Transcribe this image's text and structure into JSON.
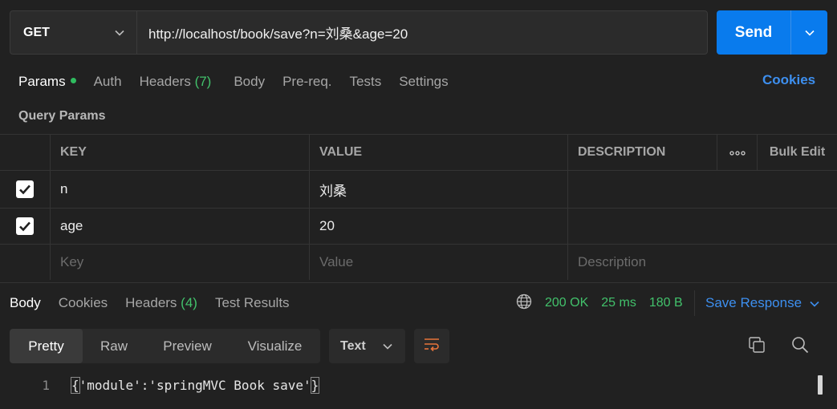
{
  "request": {
    "method": "GET",
    "url": "http://localhost/book/save?n=刘桑&age=20",
    "send_label": "Send"
  },
  "request_tabs": [
    {
      "label": "Params",
      "active": true,
      "dot": true
    },
    {
      "label": "Auth"
    },
    {
      "label": "Headers",
      "count": "(7)"
    },
    {
      "label": "Body"
    },
    {
      "label": "Pre-req."
    },
    {
      "label": "Tests"
    },
    {
      "label": "Settings"
    }
  ],
  "cookies_link": "Cookies",
  "query_params": {
    "title": "Query Params",
    "headers": {
      "key": "KEY",
      "value": "VALUE",
      "description": "DESCRIPTION",
      "bulk_edit": "Bulk Edit"
    },
    "rows": [
      {
        "checked": true,
        "key": "n",
        "value": "刘桑",
        "description": ""
      },
      {
        "checked": true,
        "key": "age",
        "value": "20",
        "description": ""
      }
    ],
    "placeholders": {
      "key": "Key",
      "value": "Value",
      "description": "Description"
    }
  },
  "response_tabs": [
    {
      "label": "Body",
      "active": true
    },
    {
      "label": "Cookies"
    },
    {
      "label": "Headers",
      "count": "(4)"
    },
    {
      "label": "Test Results"
    }
  ],
  "response_status": {
    "status": "200 OK",
    "time": "25 ms",
    "size": "180 B"
  },
  "save_response": "Save Response",
  "format_options": [
    "Pretty",
    "Raw",
    "Preview",
    "Visualize"
  ],
  "format_select": "Text",
  "code": {
    "line_number": "1",
    "open_brace": "{",
    "content": "'module':'springMVC Book save'",
    "close_brace": "}"
  },
  "colors": {
    "accent": "#097bed",
    "link": "#3d8fef",
    "success": "#42c16b",
    "background": "#212121"
  },
  "icons": [
    "chevron-down-icon",
    "checkbox-checked-icon",
    "more-horizontal-icon",
    "globe-icon",
    "wrap-lines-icon",
    "copy-icon",
    "search-icon"
  ]
}
